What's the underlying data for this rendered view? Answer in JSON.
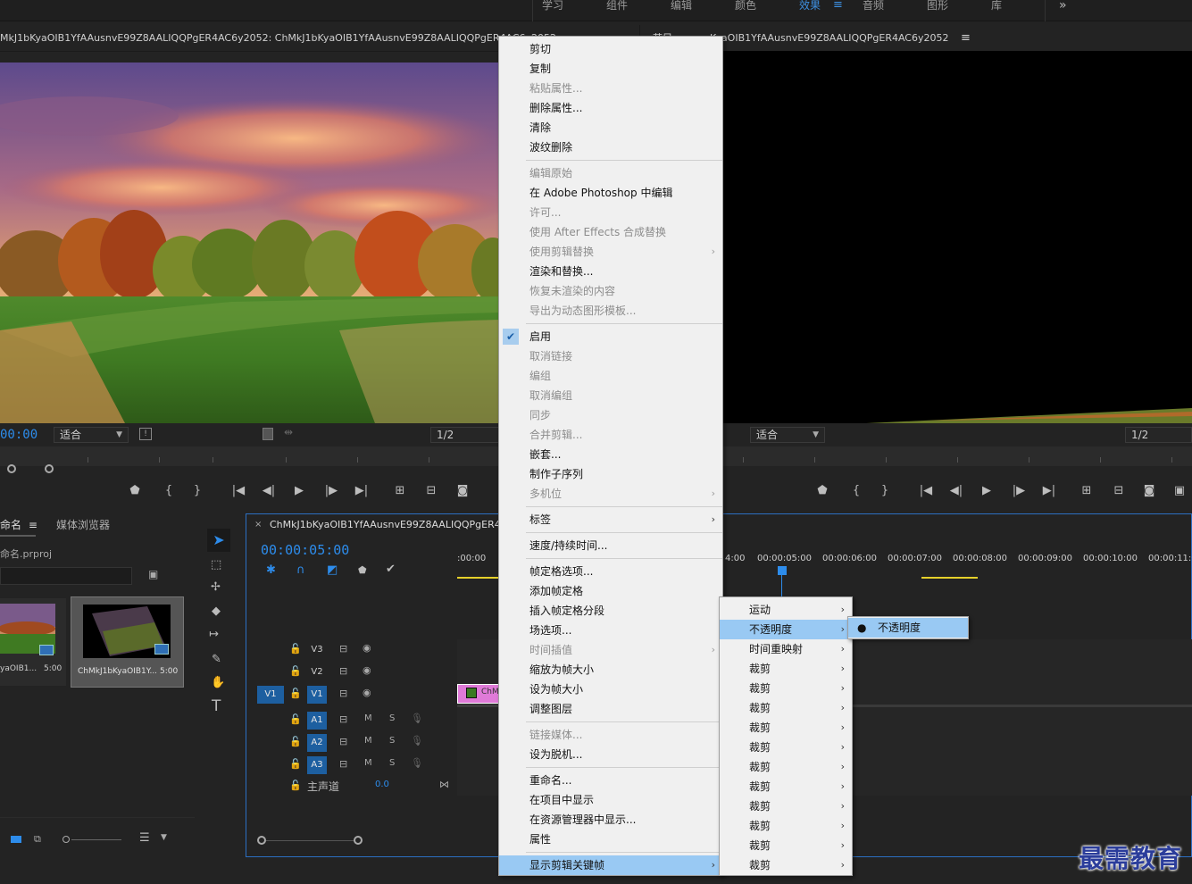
{
  "workspace_tabs": [
    "学习",
    "组件",
    "编辑",
    "颜色",
    "效果",
    "音频",
    "图形",
    "库"
  ],
  "active_workspace": "效果",
  "overflow_label": "»",
  "source_monitor": {
    "tab_title": "MkJ1bKyaOIB1YfAAusnvE99Z8AALIQQPgER4AC6y2052: ChMkJ1bKyaOIB1YfAAusnvE99Z8AALIQQPgER4AC6y2052",
    "timecode": "00:00",
    "fit_label": "适合",
    "resolution": "1/2"
  },
  "program_monitor": {
    "tab_title": "节目: ChMkJ1bKyaOIB1YfAAusnvE99Z8AALIQQPgER4AC6y2052",
    "tab_prefix": "节目",
    "tab_rest": "KyaOIB1YfAAusnvE99Z8AALIQQPgER4AC6y2052",
    "fit_label": "适合",
    "resolution": "1/2"
  },
  "project_panel": {
    "tabs": [
      "命名",
      "媒体浏览器"
    ],
    "project_file": "命名.prproj",
    "items": [
      {
        "name": "yaOIB1...",
        "duration": "5:00"
      },
      {
        "name": "ChMkJ1bKyaOIB1Y...",
        "duration": "5:00"
      }
    ]
  },
  "timeline": {
    "tab_title": "ChMkJ1bKyaOIB1YfAAusnvE99Z8AALIQQPgER4AC6",
    "timecode": "00:00:05:00",
    "ruler_labels": [
      ":00:00",
      "4:00",
      "00:00:05:00",
      "00:00:06:00",
      "00:00:07:00",
      "00:00:08:00",
      "00:00:09:00",
      "00:00:10:00",
      "00:00:11:0"
    ],
    "video_tracks": [
      "V3",
      "V2",
      "V1"
    ],
    "audio_tracks": [
      "A1",
      "A2",
      "A3"
    ],
    "source_patch": "V1",
    "master_label": "主声道",
    "master_value": "0.0",
    "clip_label": "ChM",
    "mute_label": "M",
    "solo_label": "S"
  },
  "context_menu": {
    "groups": [
      [
        {
          "label": "剪切",
          "enabled": true
        },
        {
          "label": "复制",
          "enabled": true
        },
        {
          "label": "粘贴属性...",
          "enabled": false
        },
        {
          "label": "删除属性...",
          "enabled": true
        },
        {
          "label": "清除",
          "enabled": true
        },
        {
          "label": "波纹删除",
          "enabled": true
        }
      ],
      [
        {
          "label": "编辑原始",
          "enabled": false
        },
        {
          "label": "在 Adobe Photoshop 中编辑",
          "enabled": true
        },
        {
          "label": "许可...",
          "enabled": false
        },
        {
          "label": "使用 After Effects 合成替换",
          "enabled": false
        },
        {
          "label": "使用剪辑替换",
          "enabled": false,
          "submenu": true
        },
        {
          "label": "渲染和替换...",
          "enabled": true
        },
        {
          "label": "恢复未渲染的内容",
          "enabled": false
        },
        {
          "label": "导出为动态图形模板...",
          "enabled": false
        }
      ],
      [
        {
          "label": "启用",
          "enabled": true,
          "checked": true
        },
        {
          "label": "取消链接",
          "enabled": false
        },
        {
          "label": "编组",
          "enabled": false
        },
        {
          "label": "取消编组",
          "enabled": false
        },
        {
          "label": "同步",
          "enabled": false
        },
        {
          "label": "合并剪辑...",
          "enabled": false
        },
        {
          "label": "嵌套...",
          "enabled": true
        },
        {
          "label": "制作子序列",
          "enabled": true
        },
        {
          "label": "多机位",
          "enabled": false,
          "submenu": true
        }
      ],
      [
        {
          "label": "标签",
          "enabled": true,
          "submenu": true
        }
      ],
      [
        {
          "label": "速度/持续时间...",
          "enabled": true
        }
      ],
      [
        {
          "label": "帧定格选项...",
          "enabled": true
        },
        {
          "label": "添加帧定格",
          "enabled": true
        },
        {
          "label": "插入帧定格分段",
          "enabled": true
        },
        {
          "label": "场选项...",
          "enabled": true
        },
        {
          "label": "时间插值",
          "enabled": false,
          "submenu": true
        },
        {
          "label": "缩放为帧大小",
          "enabled": true
        },
        {
          "label": "设为帧大小",
          "enabled": true
        },
        {
          "label": "调整图层",
          "enabled": true
        }
      ],
      [
        {
          "label": "链接媒体...",
          "enabled": false
        },
        {
          "label": "设为脱机...",
          "enabled": true
        }
      ],
      [
        {
          "label": "重命名...",
          "enabled": true
        },
        {
          "label": "在项目中显示",
          "enabled": true
        },
        {
          "label": "在资源管理器中显示...",
          "enabled": true
        },
        {
          "label": "属性",
          "enabled": true
        }
      ],
      [
        {
          "label": "显示剪辑关键帧",
          "enabled": true,
          "submenu": true,
          "highlighted": true
        }
      ]
    ]
  },
  "keyframe_submenu": [
    {
      "label": "运动"
    },
    {
      "label": "不透明度",
      "highlighted": true
    },
    {
      "label": "时间重映射"
    },
    {
      "label": "裁剪"
    },
    {
      "label": "裁剪"
    },
    {
      "label": "裁剪"
    },
    {
      "label": "裁剪"
    },
    {
      "label": "裁剪"
    },
    {
      "label": "裁剪"
    },
    {
      "label": "裁剪"
    },
    {
      "label": "裁剪"
    },
    {
      "label": "裁剪"
    },
    {
      "label": "裁剪"
    },
    {
      "label": "裁剪"
    }
  ],
  "opacity_submenu": [
    {
      "label": "不透明度",
      "selected": true
    }
  ],
  "watermark": "最需教育",
  "colors": {
    "accent_blue": "#2d8ceb",
    "menu_highlight": "#99c9f3",
    "clip_pink": "#e07ad8",
    "track_on": "#1d5fa0"
  }
}
